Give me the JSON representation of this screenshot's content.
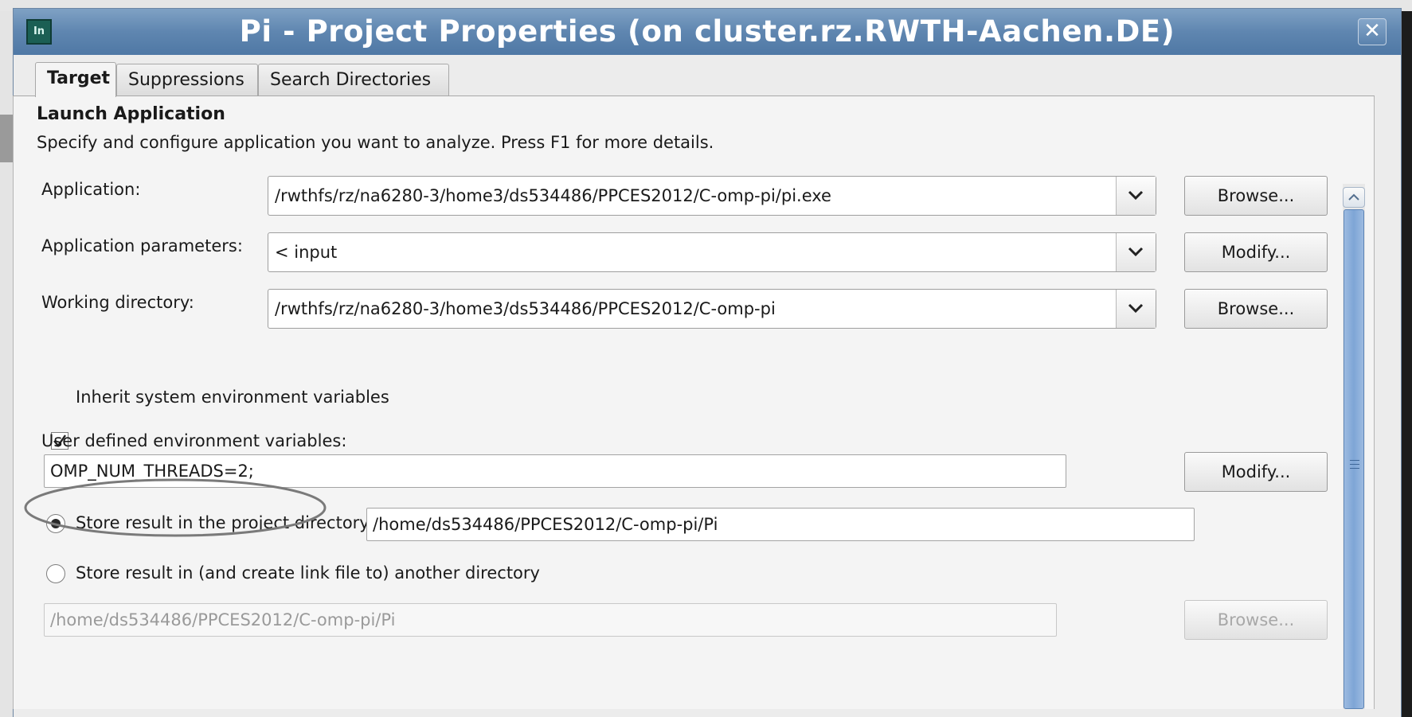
{
  "dialog": {
    "title": "Pi - Project Properties (on cluster.rz.RWTH-Aachen.DE)",
    "close_glyph": "✕"
  },
  "tabs": [
    {
      "label": "Target",
      "active": true
    },
    {
      "label": "Suppressions",
      "active": false
    },
    {
      "label": "Search Directories",
      "active": false
    }
  ],
  "section": {
    "title": "Launch Application",
    "description": "Specify and configure application you want to analyze. Press F1 for more details."
  },
  "application": {
    "label": "Application:",
    "value": "/rwthfs/rz/na6280-3/home3/ds534486/PPCES2012/C-omp-pi/pi.exe",
    "button": "Browse..."
  },
  "app_params": {
    "label": "Application parameters:",
    "value": "< input",
    "button": "Modify..."
  },
  "working_dir": {
    "label": "Working directory:",
    "value": "/rwthfs/rz/na6280-3/home3/ds534486/PPCES2012/C-omp-pi",
    "button": "Browse..."
  },
  "inherit_env": {
    "label": "Inherit system environment variables",
    "checked": true
  },
  "user_env": {
    "label": "User defined environment variables:",
    "value": "OMP_NUM_THREADS=2;",
    "button": "Modify..."
  },
  "store_project": {
    "label": "Store result in the project directory:",
    "selected": true,
    "value": "/home/ds534486/PPCES2012/C-omp-pi/Pi"
  },
  "store_other": {
    "label": "Store result in (and create link file to) another directory",
    "selected": false,
    "value": "/home/ds534486/PPCES2012/C-omp-pi/Pi",
    "button": "Browse..."
  },
  "colors": {
    "titlebar": "#5f86b0",
    "scroll_thumb": "#7ea5d6",
    "annotation": "#7a7a7a"
  },
  "icons": [
    "app-icon",
    "close-icon",
    "chevron-down-icon",
    "checkmark-icon",
    "scroll-up-icon"
  ]
}
